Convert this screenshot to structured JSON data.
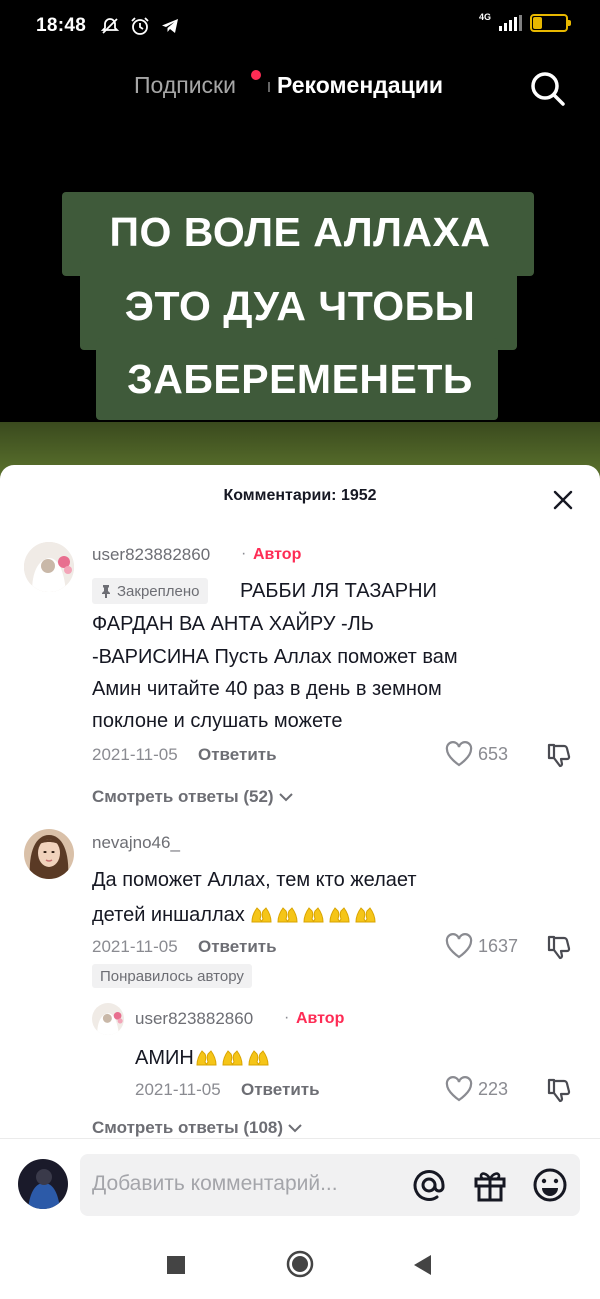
{
  "status_bar": {
    "time": "18:48",
    "network": "4G",
    "battery": "27",
    "battery_level": 0.27
  },
  "feed": {
    "tab_following": "Подписки",
    "tab_for_you": "Рекомендации"
  },
  "video": {
    "caption_lines": [
      "ПО ВОЛЕ АЛЛАХА",
      "ЭТО ДУА ЧТОБЫ",
      "ЗАБЕРЕМЕНЕТЬ"
    ]
  },
  "comments": {
    "title": "Комментарии: 1952",
    "items": [
      {
        "username": "user823882860",
        "author_label": "Автор",
        "pinned_label": "Закреплено",
        "text_lines": [
          "РАББИ ЛЯ ТАЗАРНИ",
          "ФАРДАН ВА АНТА ХАЙРУ -ЛЬ",
          "-ВАРИСИНА Пусть Аллах поможет вам",
          "Амин читайте 40 раз в день в земном",
          "поклоне и слушать можете"
        ],
        "date": "2021-11-05",
        "reply": "Ответить",
        "likes": "653",
        "view_replies": "Смотреть ответы (52)"
      },
      {
        "username": "nevajno46_",
        "text_lines": [
          "Да поможет Аллах, тем кто желает",
          "детей иншаллах"
        ],
        "emoji": "🤲🤲🤲🤲🤲",
        "date": "2021-11-05",
        "reply": "Ответить",
        "likes": "1637",
        "liked_by_author": "Понравилось автору",
        "replies": [
          {
            "username": "user823882860",
            "author_label": "Автор",
            "text": "АМИН",
            "emoji": "🤲🤲🤲",
            "date": "2021-11-05",
            "reply": "Ответить",
            "likes": "223"
          }
        ],
        "view_replies": "Смотреть ответы (108)"
      }
    ]
  },
  "input": {
    "placeholder": "Добавить комментарий..."
  },
  "colors": {
    "accent": "#fe2c55",
    "caption_bg": "#3f5a3a"
  }
}
